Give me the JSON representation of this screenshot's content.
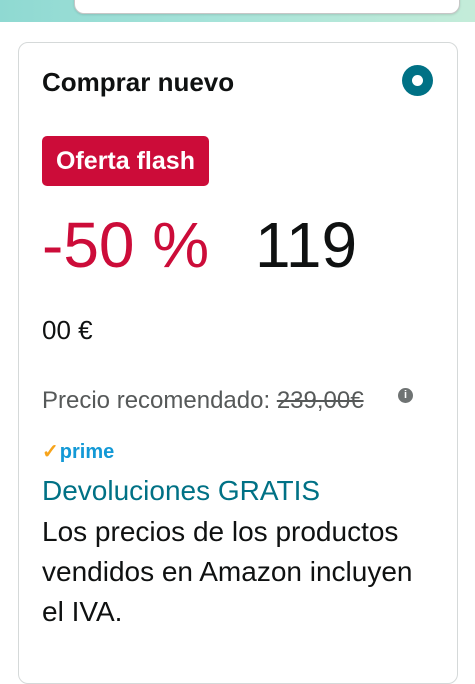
{
  "offer": {
    "title": "Comprar nuevo",
    "badge": "Oferta flash",
    "discount": "-50 %",
    "price_whole": "119",
    "price_fraction": "00 €",
    "list_price_label": "Precio recomendado:",
    "list_price_value": "239,00€",
    "info_glyph": "i",
    "prime_check": "✓",
    "prime_label": "prime",
    "returns": "Devoluciones GRATIS",
    "tax_note": "Los precios de los productos vendidos en Amazon incluyen el IVA."
  },
  "colors": {
    "accent_teal": "#007185",
    "deal_red": "#cc0c39",
    "prime_blue": "#1399d6",
    "prime_check_orange": "#f7a41b"
  }
}
